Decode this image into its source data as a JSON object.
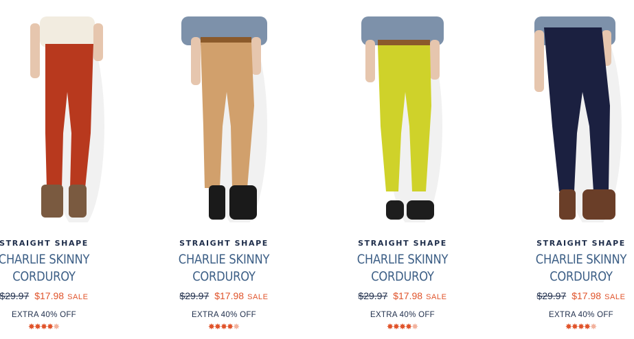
{
  "products": [
    {
      "shape": "STRAIGHT SHAPE",
      "name_line1": "CHARLIE SKINNY",
      "name_line2": "CORDUROY",
      "was_price": "$29.97",
      "sale_price": "$17.98",
      "sale_label": "SALE",
      "promo": "EXTRA 40% OFF",
      "rating": 4.5,
      "pants_color": "#b8391e",
      "top_color": "#f2ece0",
      "shoe_color": "#7a5a40"
    },
    {
      "shape": "STRAIGHT SHAPE",
      "name_line1": "CHARLIE SKINNY",
      "name_line2": "CORDUROY",
      "was_price": "$29.97",
      "sale_price": "$17.98",
      "sale_label": "SALE",
      "promo": "EXTRA 40% OFF",
      "rating": 4.5,
      "pants_color": "#d1a06c",
      "top_color": "#7d91aa",
      "shoe_color": "#1a1a1a"
    },
    {
      "shape": "STRAIGHT SHAPE",
      "name_line1": "CHARLIE SKINNY",
      "name_line2": "CORDUROY",
      "was_price": "$29.97",
      "sale_price": "$17.98",
      "sale_label": "SALE",
      "promo": "EXTRA 40% OFF",
      "rating": 4.5,
      "pants_color": "#cfd22a",
      "top_color": "#7d91aa",
      "shoe_color": "#1d1d1d"
    },
    {
      "shape": "STRAIGHT SHAPE",
      "name_line1": "CHARLIE SKINNY",
      "name_line2": "CORDUROY",
      "was_price": "$29.97",
      "sale_price": "$17.98",
      "sale_label": "SALE",
      "promo": "EXTRA 40% OFF",
      "rating": 4.5,
      "pants_color": "#1b2040",
      "top_color": "#7d91aa",
      "shoe_color": "#6a3e28"
    }
  ]
}
